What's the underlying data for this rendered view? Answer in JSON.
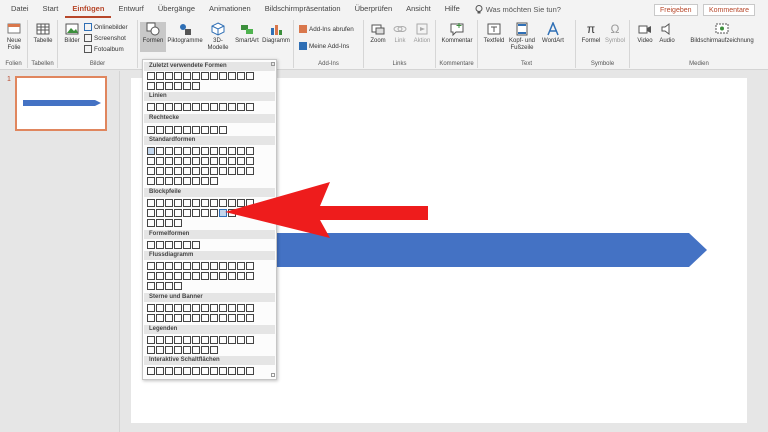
{
  "tabs": [
    "Datei",
    "Start",
    "Einfügen",
    "Entwurf",
    "Übergänge",
    "Animationen",
    "Bildschirmpräsentation",
    "Überprüfen",
    "Ansicht",
    "Hilfe"
  ],
  "active_tab": "Einfügen",
  "tell_me": "Was möchten Sie tun?",
  "share_label": "Freigeben",
  "comments_label": "Kommentare",
  "ribbon": {
    "new_slide": "Neue Folie",
    "group_slides": "Folien",
    "table": "Tabelle",
    "group_tables": "Tabellen",
    "images": "Bilder",
    "online_images": "Onlinebilder",
    "screenshot": "Screenshot",
    "photo_album": "Fotoalbum",
    "group_images": "Bilder",
    "shapes": "Formen",
    "icons": "Piktogramme",
    "models3d": "3D-Modelle",
    "smartart": "SmartArt",
    "chart": "Diagramm",
    "get_addins": "Add-Ins abrufen",
    "my_addins": "Meine Add-Ins",
    "group_addins": "Add-Ins",
    "zoom": "Zoom",
    "link": "Link",
    "action": "Aktion",
    "group_links": "Links",
    "comment": "Kommentar",
    "group_comments": "Kommentare",
    "textbox": "Textfeld",
    "header_footer": "Kopf- und Fußzeile",
    "wordart": "WordArt",
    "group_text": "Text",
    "formula": "Formel",
    "symbol": "Symbol",
    "group_symbols": "Symbole",
    "video": "Video",
    "audio": "Audio",
    "screen_recording": "Bildschirmaufzeichnung",
    "group_media": "Medien"
  },
  "slide_number": "1",
  "gallery": {
    "recent": "Zuletzt verwendete Formen",
    "lines": "Linien",
    "rectangles": "Rechtecke",
    "basic": "Standardformen",
    "block_arrows": "Blockpfeile",
    "equation": "Formelformen",
    "flowchart": "Flussdiagramm",
    "stars": "Sterne und Banner",
    "callouts": "Legenden",
    "action_buttons": "Interaktive Schaltflächen"
  },
  "colors": {
    "accent": "#b7472a",
    "shape_blue": "#4472c4",
    "pointer_red": "#ee1c1c"
  }
}
